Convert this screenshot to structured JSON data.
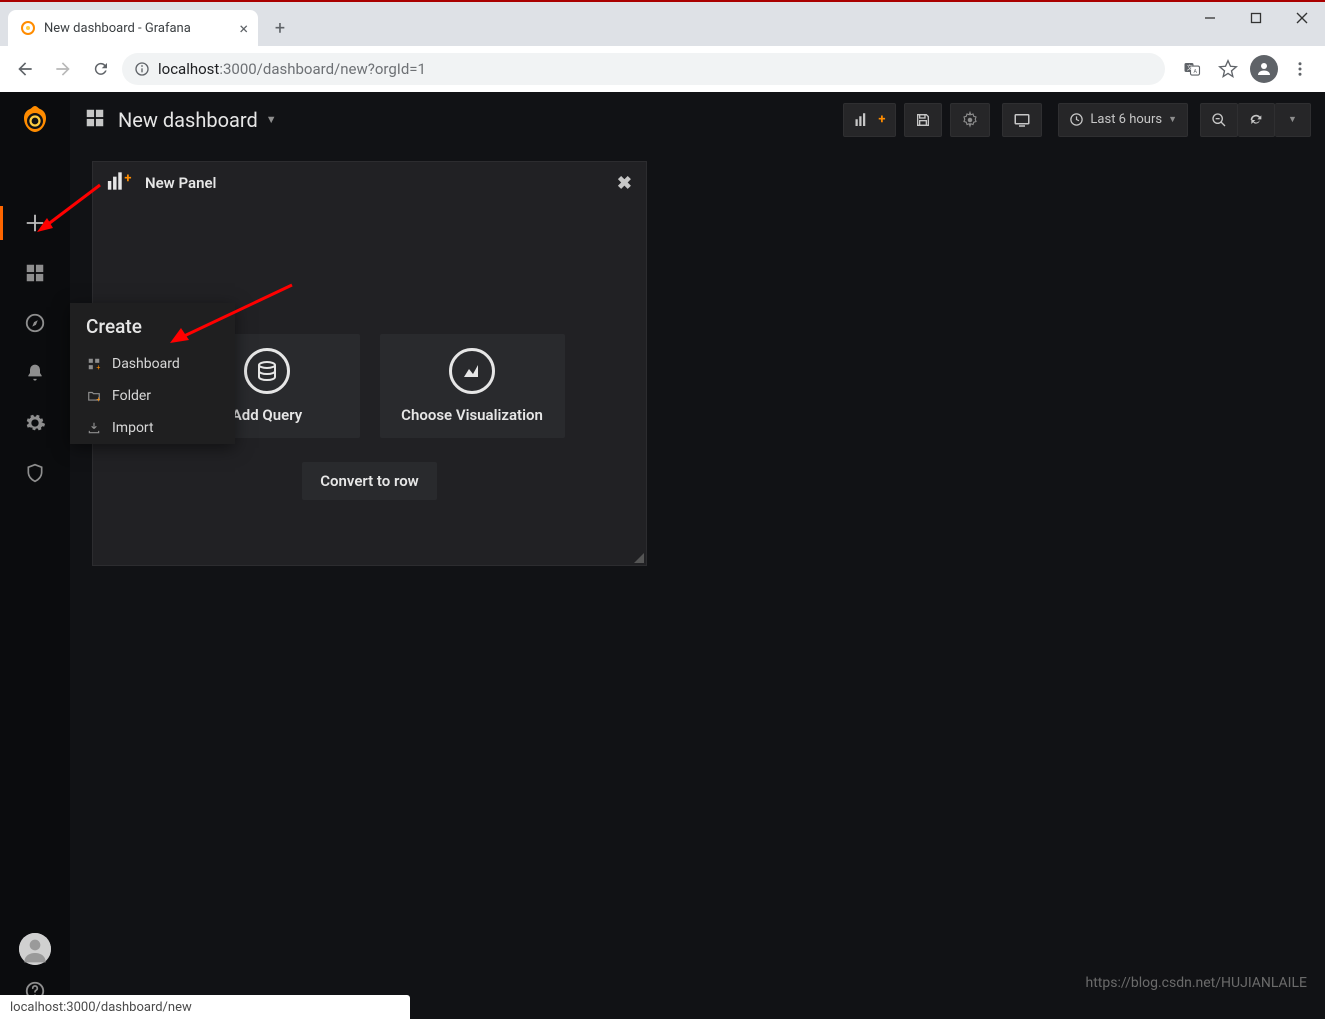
{
  "browser": {
    "tab_title": "New dashboard - Grafana",
    "url_host": "localhost",
    "url_port_path": ":3000/dashboard/new?orgId=1",
    "status_url": "localhost:3000/dashboard/new"
  },
  "grafana": {
    "dashboard_title": "New dashboard",
    "time_range": "Last 6 hours",
    "submenu": {
      "title": "Create",
      "items": [
        {
          "label": "Dashboard"
        },
        {
          "label": "Folder"
        },
        {
          "label": "Import"
        }
      ]
    },
    "panel": {
      "title": "New Panel",
      "add_query": "Add Query",
      "choose_viz": "Choose Visualization",
      "convert": "Convert to row"
    }
  },
  "watermark": "https://blog.csdn.net/HUJIANLAILE"
}
